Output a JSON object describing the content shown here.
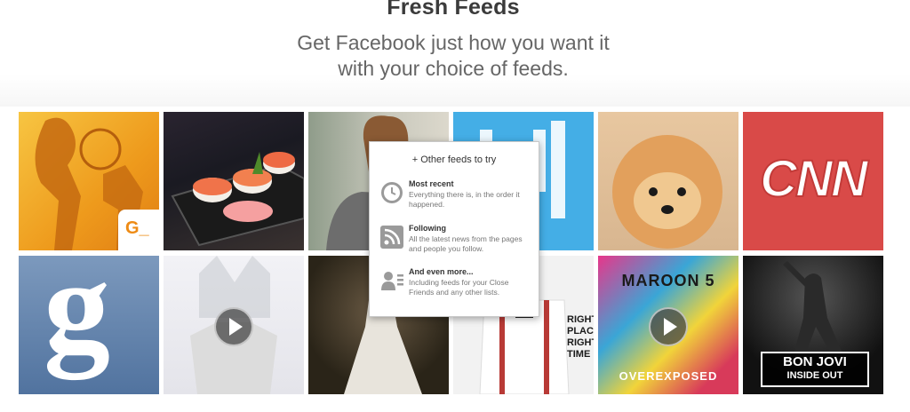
{
  "header": {
    "title": "Fresh Feeds",
    "subtitle_line1": "Get Facebook just how you want it",
    "subtitle_line2": "with your choice of feeds."
  },
  "tiles": {
    "games_badge": "G_",
    "cnn_logo": "CNN",
    "guardian_letter": "g",
    "maroon5_text": "MAROON 5",
    "overexposed_text": "OVEREXPOSED",
    "bonjovi_line1": "BON JOVI",
    "bonjovi_line2": "INSIDE OUT",
    "album_text": "RIGHT PLACE RIGHT TIME"
  },
  "popup": {
    "heading": "+ Other feeds to try",
    "items": [
      {
        "title": "Most recent",
        "desc": "Everything there is, in the order it happened.",
        "icon": "clock-icon"
      },
      {
        "title": "Following",
        "desc": "All the latest news from the pages and people you follow.",
        "icon": "rss-icon"
      },
      {
        "title": "And even more...",
        "desc": "Including feeds for your Close Friends and any other lists.",
        "icon": "contact-list-icon"
      }
    ]
  },
  "colors": {
    "games_orange": "#f0a020",
    "cnn_red": "#d94a48",
    "blue_tile": "#44aee6",
    "guardian_blue": "#5f86b5"
  }
}
